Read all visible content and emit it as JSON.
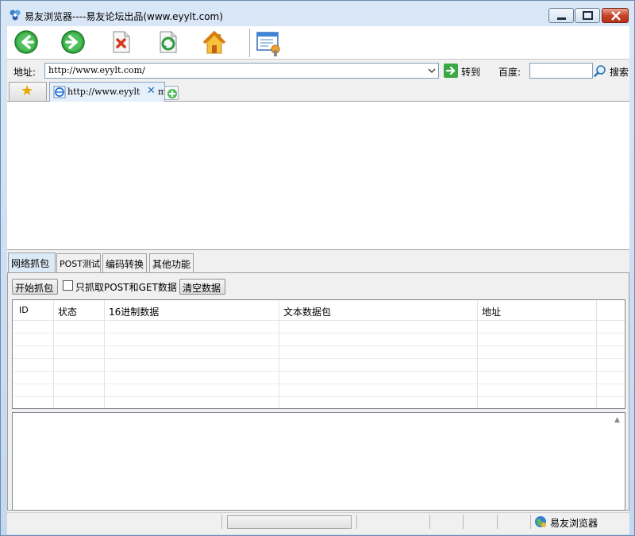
{
  "window": {
    "title": "易友浏览器----易友论坛出品(www.eyylt.com)",
    "app_icon": "app-logo-icon"
  },
  "toolbar": {
    "buttons": [
      {
        "name": "back-button",
        "icon": "back-arrow-icon"
      },
      {
        "name": "forward-button",
        "icon": "forward-arrow-icon"
      },
      {
        "name": "stop-button",
        "icon": "stop-x-icon"
      },
      {
        "name": "refresh-button",
        "icon": "refresh-icon"
      },
      {
        "name": "home-button",
        "icon": "home-icon"
      },
      {
        "name": "settings-button",
        "icon": "window-settings-icon"
      }
    ]
  },
  "addressbar": {
    "label": "地址:",
    "url": "http://www.eyylt.com/",
    "goto_label": "转到",
    "baidu_label": "百度:",
    "baidu_value": "",
    "search_label": "搜索"
  },
  "tabstrip": {
    "page_tab_text": "http://www.eyylt",
    "page_tab_suffix": "m",
    "close_glyph": "✕"
  },
  "bottom_tabs": [
    "网络抓包",
    "POST测试",
    "编码转换",
    "其他功能"
  ],
  "capture": {
    "start_label": "开始抓包",
    "filter_label": "只抓取POST和GET数据",
    "filter_checked": false,
    "clear_label": "清空数据",
    "columns": [
      "ID",
      "状态",
      "16进制数据",
      "文本数据包",
      "地址"
    ],
    "rows": []
  },
  "statusbar": {
    "app_name": "易友浏览器",
    "progress": 0
  },
  "colors": {
    "accent": "#2a6db5",
    "close_red": "#c7442a",
    "go_green": "#3aa845"
  }
}
